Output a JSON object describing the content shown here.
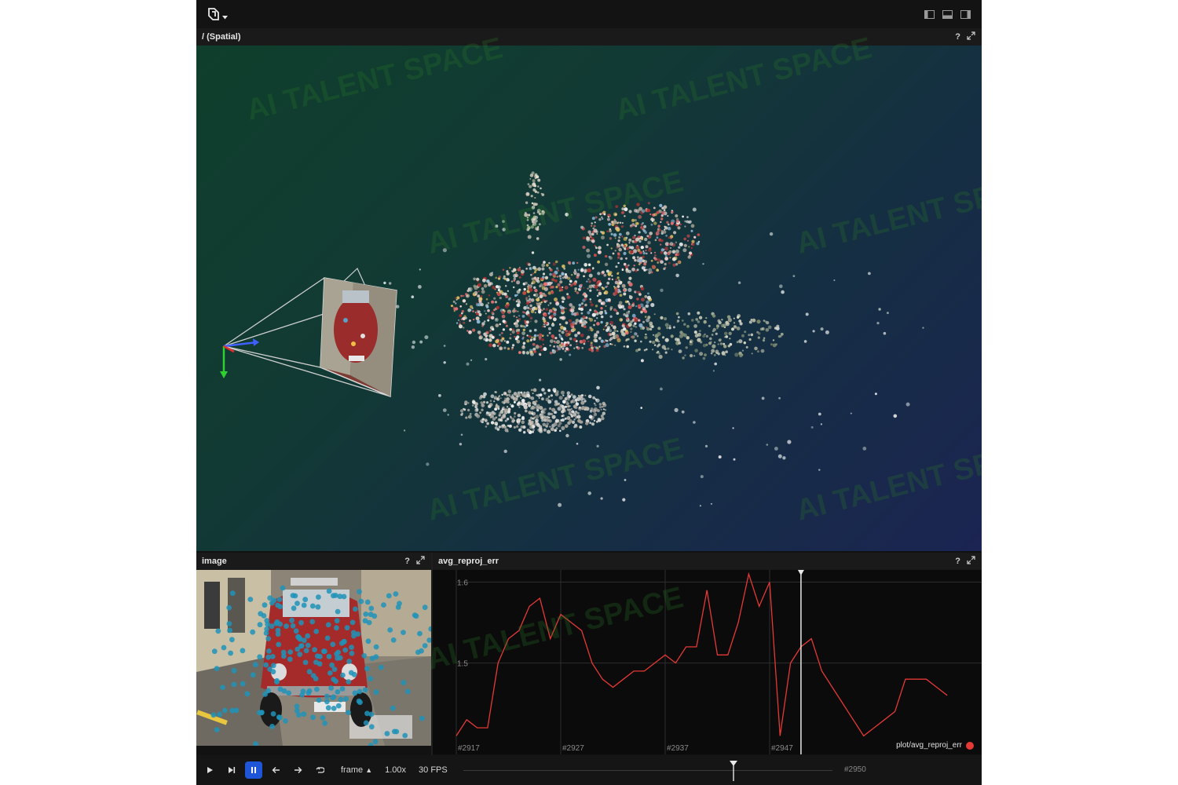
{
  "watermark": "AI TALENT SPACE",
  "spatial": {
    "title": "/ (Spatial)",
    "help": "?"
  },
  "image_panel": {
    "title": "image",
    "help": "?"
  },
  "plot_panel": {
    "title": "avg_reproj_err",
    "help": "?",
    "legend": "plot/avg_reproj_err"
  },
  "timebar": {
    "timeline_name": "frame",
    "timeline_arrow": "▲",
    "speed": "1.00x",
    "fps": "30 FPS",
    "end_label": "#2950"
  },
  "colors": {
    "accent": "#1f56d8",
    "series": "#e53935",
    "background": "#121212"
  },
  "chart_data": {
    "type": "line",
    "series": [
      {
        "name": "plot/avg_reproj_err",
        "x": [
          2917,
          2918,
          2919,
          2920,
          2921,
          2922,
          2923,
          2924,
          2925,
          2926,
          2927,
          2928,
          2929,
          2930,
          2931,
          2932,
          2933,
          2934,
          2935,
          2936,
          2937,
          2938,
          2939,
          2940,
          2941,
          2942,
          2943,
          2944,
          2945,
          2946,
          2947,
          2948,
          2949,
          2950,
          2951,
          2952,
          2953,
          2954,
          2955,
          2956,
          2957,
          2958,
          2959,
          2960,
          2961,
          2962,
          2963,
          2964
        ],
        "values": [
          1.41,
          1.43,
          1.42,
          1.42,
          1.5,
          1.53,
          1.54,
          1.57,
          1.58,
          1.53,
          1.56,
          1.55,
          1.54,
          1.5,
          1.48,
          1.47,
          1.48,
          1.49,
          1.49,
          1.5,
          1.51,
          1.5,
          1.52,
          1.52,
          1.59,
          1.51,
          1.51,
          1.55,
          1.61,
          1.57,
          1.6,
          1.41,
          1.5,
          1.52,
          1.53,
          1.49,
          1.47,
          1.45,
          1.43,
          1.41,
          1.42,
          1.43,
          1.44,
          1.48,
          1.48,
          1.48,
          1.47,
          1.46
        ],
        "color": "#e53935"
      }
    ],
    "xticks": [
      "#2917",
      "#2927",
      "#2937",
      "#2947"
    ],
    "yticks": [
      "1.6",
      "1.5"
    ],
    "xlim": [
      2917,
      2967.3
    ],
    "ylim": [
      1.39,
      1.615
    ],
    "cursor_x": 2950,
    "grid": true,
    "legend_position": "bottom-right"
  }
}
